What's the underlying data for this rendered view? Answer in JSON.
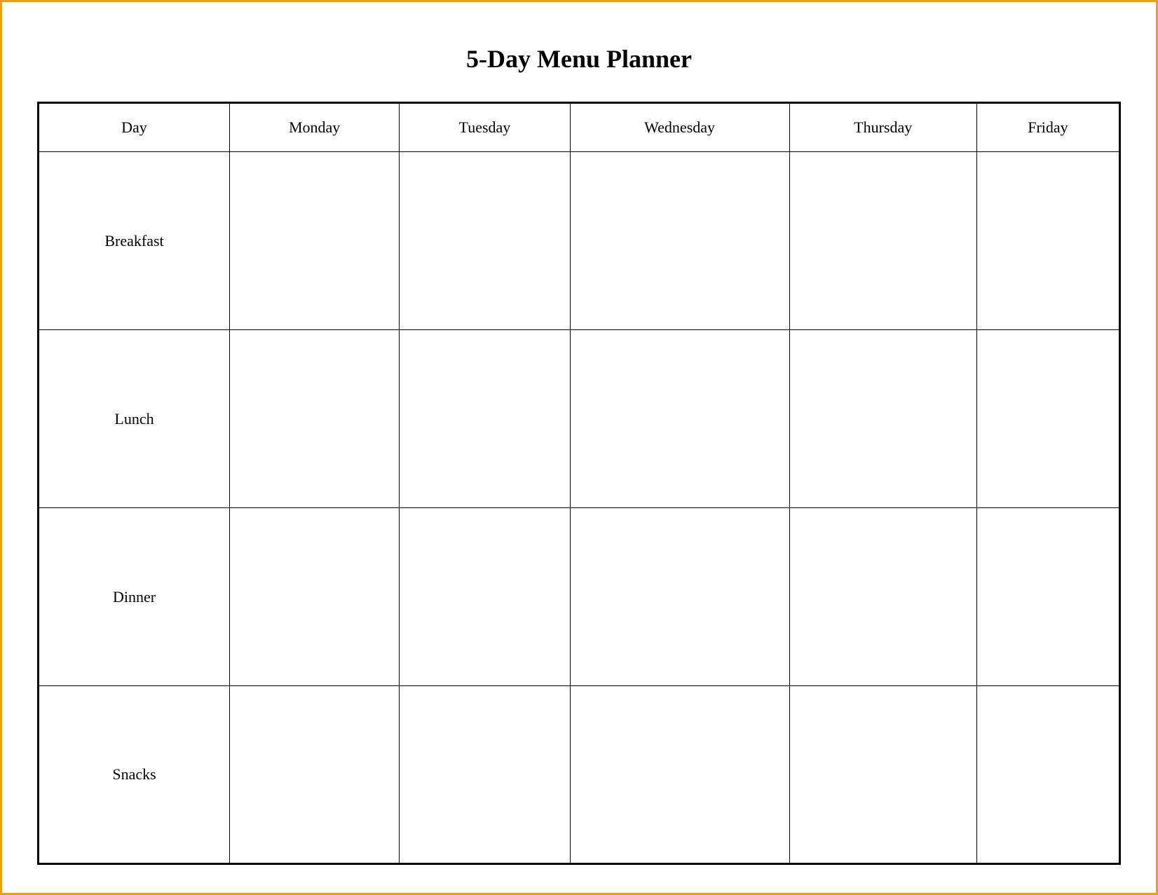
{
  "title": "5-Day Menu Planner",
  "table": {
    "headers": [
      {
        "id": "day",
        "label": "Day"
      },
      {
        "id": "monday",
        "label": "Monday"
      },
      {
        "id": "tuesday",
        "label": "Tuesday"
      },
      {
        "id": "wednesday",
        "label": "Wednesday"
      },
      {
        "id": "thursday",
        "label": "Thursday"
      },
      {
        "id": "friday",
        "label": "Friday"
      }
    ],
    "rows": [
      {
        "meal": "Breakfast",
        "monday": "",
        "tuesday": "",
        "wednesday": "",
        "thursday": "",
        "friday": ""
      },
      {
        "meal": "Lunch",
        "monday": "",
        "tuesday": "",
        "wednesday": "",
        "thursday": "",
        "friday": ""
      },
      {
        "meal": "Dinner",
        "monday": "",
        "tuesday": "",
        "wednesday": "",
        "thursday": "",
        "friday": ""
      },
      {
        "meal": "Snacks",
        "monday": "",
        "tuesday": "",
        "wednesday": "",
        "thursday": "",
        "friday": ""
      }
    ]
  }
}
